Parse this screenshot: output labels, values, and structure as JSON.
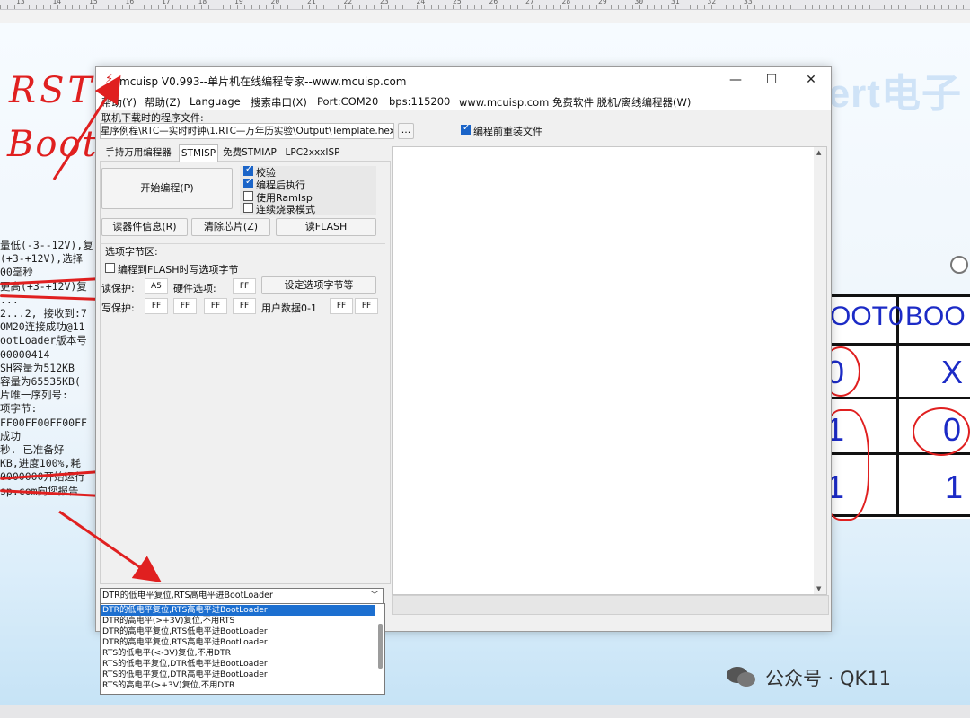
{
  "ruler": {
    "labels": [
      "13",
      "14",
      "15",
      "16",
      "17",
      "18",
      "19",
      "20",
      "21",
      "22",
      "23",
      "24",
      "25",
      "26",
      "27",
      "28",
      "29",
      "30",
      "31",
      "32",
      "33"
    ]
  },
  "slide": {
    "brand": "Expert电子",
    "handwriting": {
      "rst": "RST",
      "boot": "Boot"
    },
    "console_lines": [
      "量低(-3--12V),复",
      "(+3-+12V),选择",
      "00毫秒",
      "更高(+3-+12V)复",
      "...",
      "2...2, 接收到:7",
      "OM20连接成功@11",
      "ootLoader版本号",
      "  00000414",
      "SH容量为512KB",
      "容量为65535KB(",
      "片唯一序列号:",
      "项字节:",
      "FF00FF00FF00FF",
      "成功",
      "秒. 已准备好",
      "KB,进度100%,耗",
      "0000000开始运行",
      "sp.com向您报告"
    ],
    "table": {
      "headers": [
        "OOT0",
        "BOO"
      ],
      "rows": [
        [
          "0",
          "X"
        ],
        [
          "1",
          "0"
        ],
        [
          "1",
          "1"
        ]
      ]
    },
    "watermark": "公众号 · QK11"
  },
  "app": {
    "title": "mcuisp V0.993--单片机在线编程专家--www.mcuisp.com",
    "window_buttons": {
      "minimize": "—",
      "maximize": "☐",
      "close": "✕"
    },
    "menu": [
      "帮助(Y)",
      "帮助(Z)",
      "Language",
      "搜索串口(X)",
      "Port:COM20",
      "bps:115200",
      "www.mcuisp.com 免费软件 脱机/离线编程器(W)"
    ],
    "file_label": "联机下载时的程序文件:",
    "file_path": "星序例程\\RTC—实时时钟\\1.RTC—万年历实验\\Output\\Template.hex",
    "browse_button": "...",
    "reload_checkbox": "编程前重装文件",
    "tabs": [
      "手持万用编程器",
      "STMISP",
      "免费STMIAP",
      "LPC2xxxISP"
    ],
    "start_button": "开始编程(P)",
    "options": [
      {
        "label": "校验",
        "checked": true
      },
      {
        "label": "编程后执行",
        "checked": true
      },
      {
        "label": "使用RamIsp",
        "checked": false
      },
      {
        "label": "连续烧录模式",
        "checked": false
      }
    ],
    "action_buttons": [
      "读器件信息(R)",
      "清除芯片(Z)",
      "读FLASH"
    ],
    "option_bytes": {
      "group_label": "选项字节区:",
      "write_checkbox": "编程到FLASH时写选项字节",
      "read_protect_label": "读保护:",
      "read_protect_value": "A5",
      "hw_option_label": "硬件选项:",
      "hw_option_value": "FF",
      "set_button": "设定选项字节等",
      "write_protect_label": "写保护:",
      "write_protect_values": [
        "FF",
        "FF",
        "FF",
        "FF"
      ],
      "user_data_label": "用户数据0-1",
      "user_data_values": [
        "FF",
        "FF"
      ]
    },
    "dropdown": {
      "selected": "DTR的低电平复位,RTS高电平进BootLoader",
      "options": [
        "DTR的低电平复位,RTS高电平进BootLoader",
        "DTR的高电平(>+3V)复位,不用RTS",
        "DTR的高电平复位,RTS低电平进BootLoader",
        "DTR的高电平复位,RTS高电平进BootLoader",
        "RTS的低电平(<-3V)复位,不用DTR",
        "RTS的低电平复位,DTR低电平进BootLoader",
        "RTS的低电平复位,DTR高电平进BootLoader",
        "RTS的高电平(>+3V)复位,不用DTR"
      ]
    }
  },
  "colors": {
    "accent": "#1c6fd0",
    "annotation": "#e02020",
    "table_text": "#1c2bc6"
  }
}
